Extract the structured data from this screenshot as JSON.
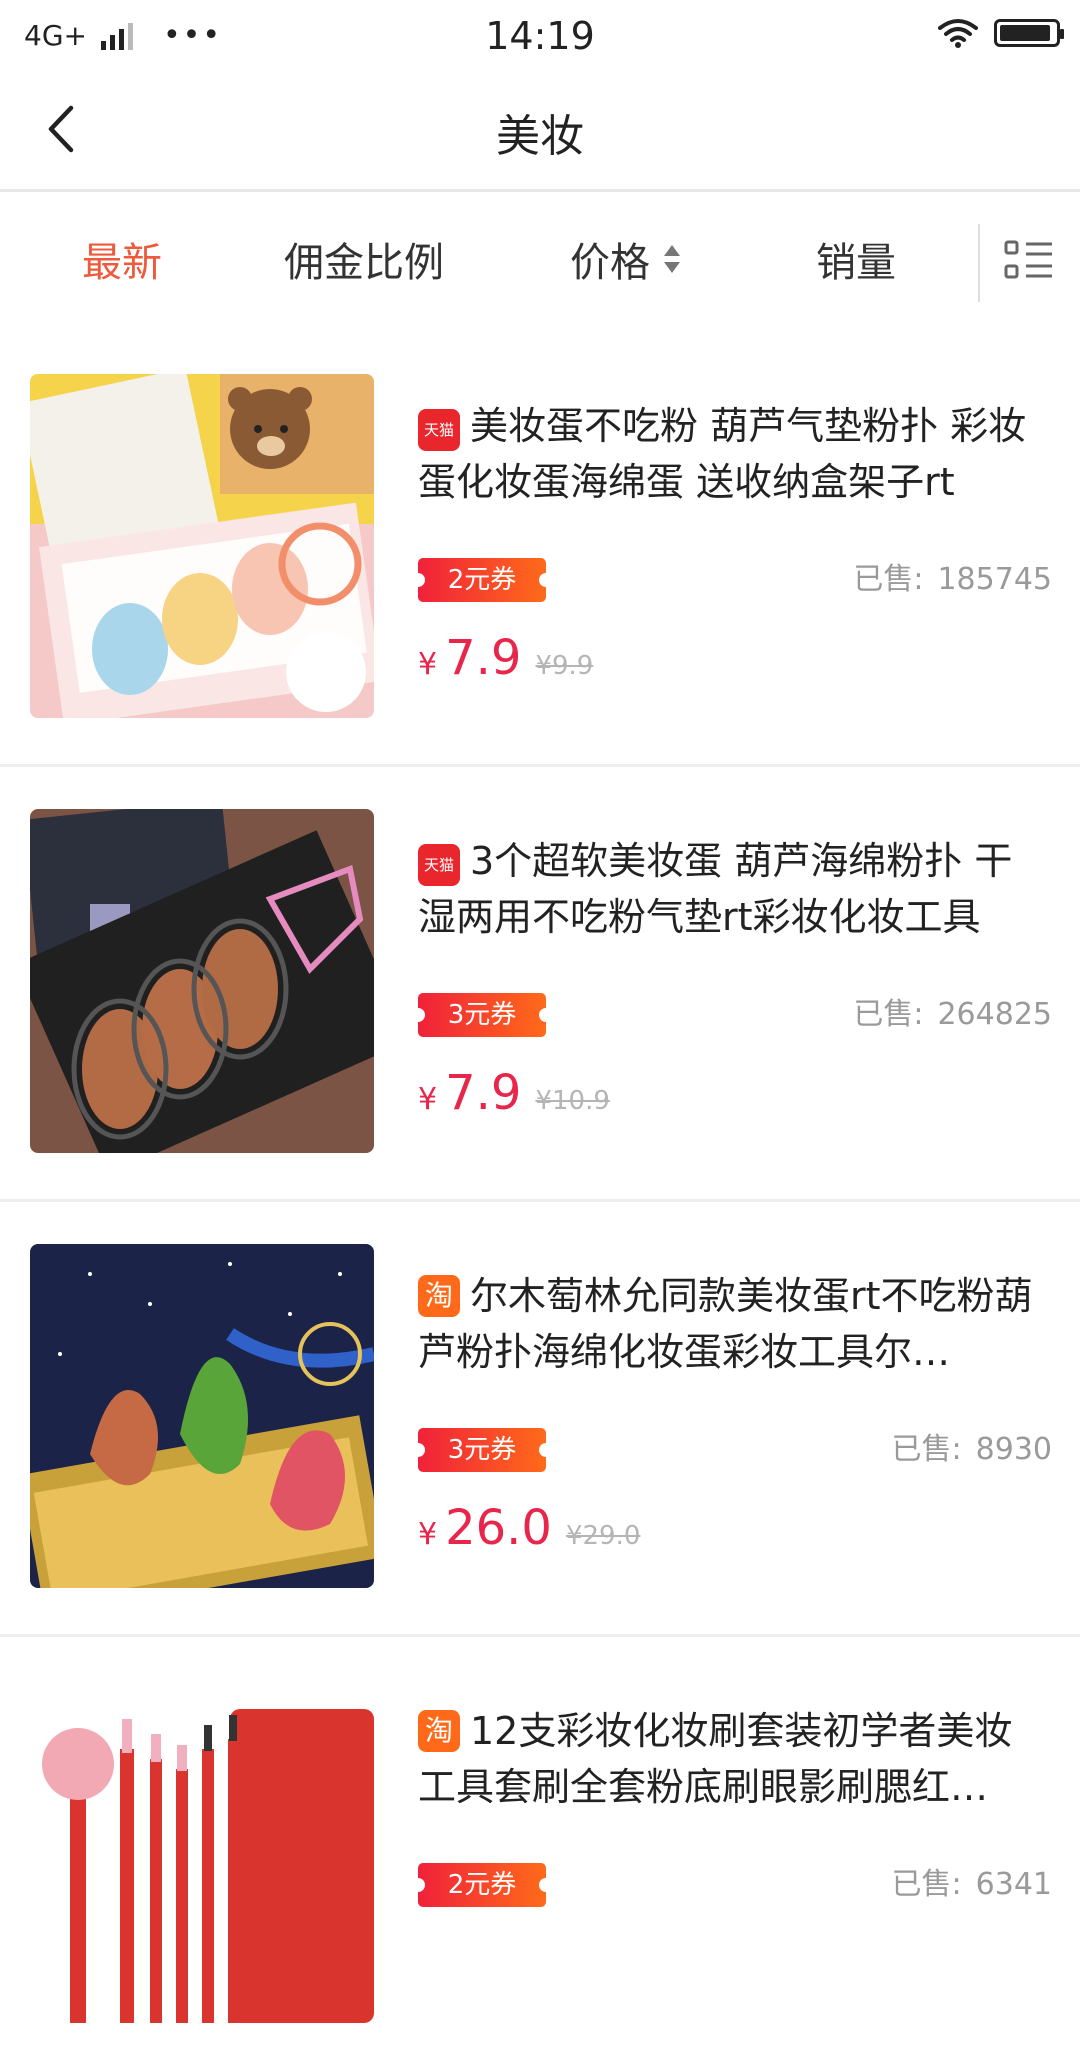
{
  "status_bar": {
    "network": "4G+",
    "dots": "•••",
    "time": "14:19"
  },
  "nav": {
    "title": "美妆"
  },
  "sort_tabs": [
    {
      "label": "最新",
      "active": true
    },
    {
      "label": "佣金比例",
      "active": false
    },
    {
      "label": "价格",
      "active": false
    },
    {
      "label": "销量",
      "active": false
    }
  ],
  "colors": {
    "accent": "#ee5a3c",
    "price": "#e8254a",
    "coupon_start": "#f0213a",
    "coupon_end": "#ff6a1a",
    "tmall": "#e8262c",
    "taobao": "#ff6a1a"
  },
  "products": [
    {
      "shop": "天猫",
      "shop_type": "tmall",
      "title": "美妆蛋不吃粉 葫芦气垫粉扑 彩妆蛋化妆蛋海绵蛋 送收纳盒架子rt",
      "coupon": "2元券",
      "sold_label": "已售:",
      "sold": "185745",
      "currency": "¥",
      "price": "7.9",
      "original_price": "¥9.9",
      "image": "sponge-box-set"
    },
    {
      "shop": "天猫",
      "shop_type": "tmall",
      "title": "3个超软美妆蛋 葫芦海绵粉扑 干湿两用不吃粉气垫rt彩妆化妆工具",
      "coupon": "3元券",
      "sold_label": "已售:",
      "sold": "264825",
      "currency": "¥",
      "price": "7.9",
      "original_price": "¥10.9",
      "image": "sponge-dark-box"
    },
    {
      "shop": "淘",
      "shop_type": "taobao",
      "title": "尔木萄林允同款美妆蛋rt不吃粉葫芦粉扑海绵化妆蛋彩妆工具尔…",
      "coupon": "3元券",
      "sold_label": "已售:",
      "sold": "8930",
      "currency": "¥",
      "price": "26.0",
      "original_price": "¥29.0",
      "image": "sponge-gold-tray"
    },
    {
      "shop": "淘",
      "shop_type": "taobao",
      "title": "12支彩妆化妆刷套装初学者美妆工具套刷全套粉底刷眼影刷腮红…",
      "coupon": "2元券",
      "sold_label": "已售:",
      "sold": "6341",
      "currency": "¥",
      "price": "",
      "original_price": "",
      "image": "brush-set"
    }
  ]
}
